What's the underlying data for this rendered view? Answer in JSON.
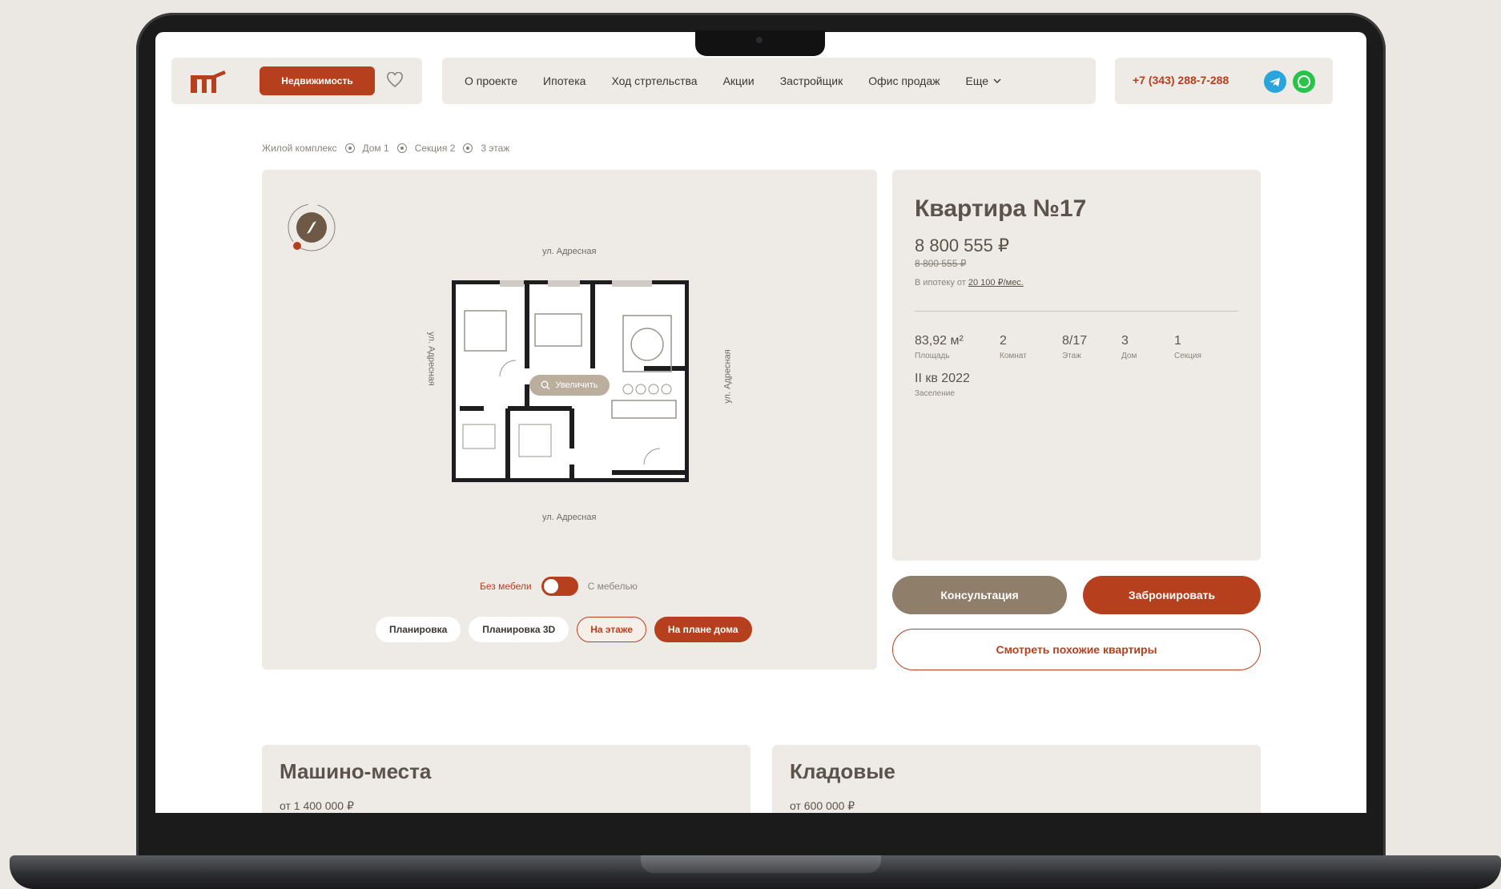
{
  "header": {
    "estate_button": "Недвижимость",
    "nav": [
      "О проекте",
      "Ипотека",
      "Ход стртельства",
      "Акции",
      "Застройщик",
      "Офис продаж",
      "Еще"
    ],
    "phone": "+7 (343) 288-7-288"
  },
  "breadcrumb": [
    "Жилой комплекс",
    "Дом 1",
    "Секция 2",
    "3 этаж"
  ],
  "plan": {
    "street_top": "ул. Адресная",
    "street_bottom": "ул. Адресная",
    "street_left": "ул. Адресная",
    "street_right": "ул. Адресная",
    "zoom_label": "Увеличить",
    "toggle_off": "Без мебели",
    "toggle_on": "С мебелью",
    "views": [
      "Планировка",
      "Планировка 3D",
      "На этаже",
      "На плане дома"
    ]
  },
  "apartment": {
    "title": "Квартира №17",
    "price": "8 800 555 ₽",
    "old_price": "8 800 555 ₽",
    "mortgage_prefix": "В ипотеку от",
    "mortgage_value": "20 100 ₽/мес.",
    "specs": [
      {
        "value": "83,92 м²",
        "label": "Площадь"
      },
      {
        "value": "2",
        "label": "Комнат"
      },
      {
        "value": "8/17",
        "label": "Этаж"
      },
      {
        "value": "3",
        "label": "Дом"
      },
      {
        "value": "1",
        "label": "Секция"
      }
    ],
    "settlement_value": "II кв 2022",
    "settlement_label": "Заселение"
  },
  "actions": {
    "consult": "Консультация",
    "book": "Забронировать",
    "similar": "Смотреть похожие квартиры"
  },
  "cards": [
    {
      "title": "Машино-места",
      "price": "от 1 400 000 ₽"
    },
    {
      "title": "Кладовые",
      "price": "от 600 000 ₽"
    }
  ],
  "colors": {
    "accent": "#b6401e",
    "panel": "#eeebe6",
    "consult": "#8f7e6a"
  }
}
